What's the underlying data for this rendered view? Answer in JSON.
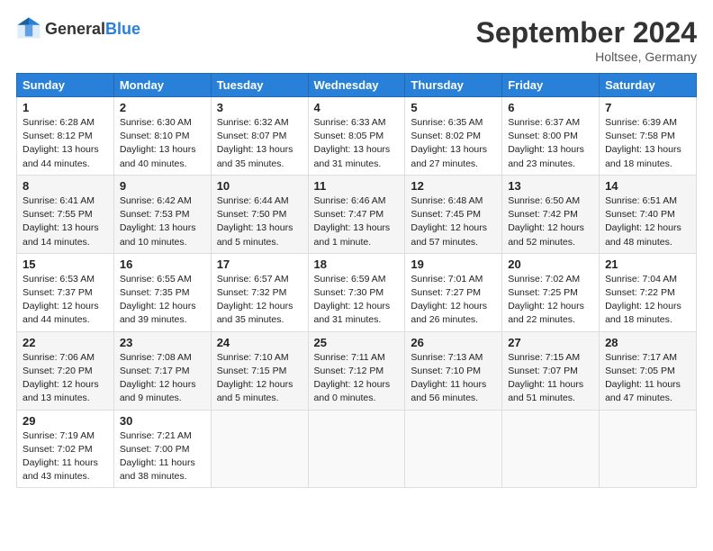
{
  "header": {
    "logo_general": "General",
    "logo_blue": "Blue",
    "title": "September 2024",
    "location": "Holtsee, Germany"
  },
  "days_of_week": [
    "Sunday",
    "Monday",
    "Tuesday",
    "Wednesday",
    "Thursday",
    "Friday",
    "Saturday"
  ],
  "weeks": [
    [
      {
        "day": "1",
        "sunrise": "Sunrise: 6:28 AM",
        "sunset": "Sunset: 8:12 PM",
        "daylight": "Daylight: 13 hours and 44 minutes."
      },
      {
        "day": "2",
        "sunrise": "Sunrise: 6:30 AM",
        "sunset": "Sunset: 8:10 PM",
        "daylight": "Daylight: 13 hours and 40 minutes."
      },
      {
        "day": "3",
        "sunrise": "Sunrise: 6:32 AM",
        "sunset": "Sunset: 8:07 PM",
        "daylight": "Daylight: 13 hours and 35 minutes."
      },
      {
        "day": "4",
        "sunrise": "Sunrise: 6:33 AM",
        "sunset": "Sunset: 8:05 PM",
        "daylight": "Daylight: 13 hours and 31 minutes."
      },
      {
        "day": "5",
        "sunrise": "Sunrise: 6:35 AM",
        "sunset": "Sunset: 8:02 PM",
        "daylight": "Daylight: 13 hours and 27 minutes."
      },
      {
        "day": "6",
        "sunrise": "Sunrise: 6:37 AM",
        "sunset": "Sunset: 8:00 PM",
        "daylight": "Daylight: 13 hours and 23 minutes."
      },
      {
        "day": "7",
        "sunrise": "Sunrise: 6:39 AM",
        "sunset": "Sunset: 7:58 PM",
        "daylight": "Daylight: 13 hours and 18 minutes."
      }
    ],
    [
      {
        "day": "8",
        "sunrise": "Sunrise: 6:41 AM",
        "sunset": "Sunset: 7:55 PM",
        "daylight": "Daylight: 13 hours and 14 minutes."
      },
      {
        "day": "9",
        "sunrise": "Sunrise: 6:42 AM",
        "sunset": "Sunset: 7:53 PM",
        "daylight": "Daylight: 13 hours and 10 minutes."
      },
      {
        "day": "10",
        "sunrise": "Sunrise: 6:44 AM",
        "sunset": "Sunset: 7:50 PM",
        "daylight": "Daylight: 13 hours and 5 minutes."
      },
      {
        "day": "11",
        "sunrise": "Sunrise: 6:46 AM",
        "sunset": "Sunset: 7:47 PM",
        "daylight": "Daylight: 13 hours and 1 minute."
      },
      {
        "day": "12",
        "sunrise": "Sunrise: 6:48 AM",
        "sunset": "Sunset: 7:45 PM",
        "daylight": "Daylight: 12 hours and 57 minutes."
      },
      {
        "day": "13",
        "sunrise": "Sunrise: 6:50 AM",
        "sunset": "Sunset: 7:42 PM",
        "daylight": "Daylight: 12 hours and 52 minutes."
      },
      {
        "day": "14",
        "sunrise": "Sunrise: 6:51 AM",
        "sunset": "Sunset: 7:40 PM",
        "daylight": "Daylight: 12 hours and 48 minutes."
      }
    ],
    [
      {
        "day": "15",
        "sunrise": "Sunrise: 6:53 AM",
        "sunset": "Sunset: 7:37 PM",
        "daylight": "Daylight: 12 hours and 44 minutes."
      },
      {
        "day": "16",
        "sunrise": "Sunrise: 6:55 AM",
        "sunset": "Sunset: 7:35 PM",
        "daylight": "Daylight: 12 hours and 39 minutes."
      },
      {
        "day": "17",
        "sunrise": "Sunrise: 6:57 AM",
        "sunset": "Sunset: 7:32 PM",
        "daylight": "Daylight: 12 hours and 35 minutes."
      },
      {
        "day": "18",
        "sunrise": "Sunrise: 6:59 AM",
        "sunset": "Sunset: 7:30 PM",
        "daylight": "Daylight: 12 hours and 31 minutes."
      },
      {
        "day": "19",
        "sunrise": "Sunrise: 7:01 AM",
        "sunset": "Sunset: 7:27 PM",
        "daylight": "Daylight: 12 hours and 26 minutes."
      },
      {
        "day": "20",
        "sunrise": "Sunrise: 7:02 AM",
        "sunset": "Sunset: 7:25 PM",
        "daylight": "Daylight: 12 hours and 22 minutes."
      },
      {
        "day": "21",
        "sunrise": "Sunrise: 7:04 AM",
        "sunset": "Sunset: 7:22 PM",
        "daylight": "Daylight: 12 hours and 18 minutes."
      }
    ],
    [
      {
        "day": "22",
        "sunrise": "Sunrise: 7:06 AM",
        "sunset": "Sunset: 7:20 PM",
        "daylight": "Daylight: 12 hours and 13 minutes."
      },
      {
        "day": "23",
        "sunrise": "Sunrise: 7:08 AM",
        "sunset": "Sunset: 7:17 PM",
        "daylight": "Daylight: 12 hours and 9 minutes."
      },
      {
        "day": "24",
        "sunrise": "Sunrise: 7:10 AM",
        "sunset": "Sunset: 7:15 PM",
        "daylight": "Daylight: 12 hours and 5 minutes."
      },
      {
        "day": "25",
        "sunrise": "Sunrise: 7:11 AM",
        "sunset": "Sunset: 7:12 PM",
        "daylight": "Daylight: 12 hours and 0 minutes."
      },
      {
        "day": "26",
        "sunrise": "Sunrise: 7:13 AM",
        "sunset": "Sunset: 7:10 PM",
        "daylight": "Daylight: 11 hours and 56 minutes."
      },
      {
        "day": "27",
        "sunrise": "Sunrise: 7:15 AM",
        "sunset": "Sunset: 7:07 PM",
        "daylight": "Daylight: 11 hours and 51 minutes."
      },
      {
        "day": "28",
        "sunrise": "Sunrise: 7:17 AM",
        "sunset": "Sunset: 7:05 PM",
        "daylight": "Daylight: 11 hours and 47 minutes."
      }
    ],
    [
      {
        "day": "29",
        "sunrise": "Sunrise: 7:19 AM",
        "sunset": "Sunset: 7:02 PM",
        "daylight": "Daylight: 11 hours and 43 minutes."
      },
      {
        "day": "30",
        "sunrise": "Sunrise: 7:21 AM",
        "sunset": "Sunset: 7:00 PM",
        "daylight": "Daylight: 11 hours and 38 minutes."
      },
      null,
      null,
      null,
      null,
      null
    ]
  ]
}
